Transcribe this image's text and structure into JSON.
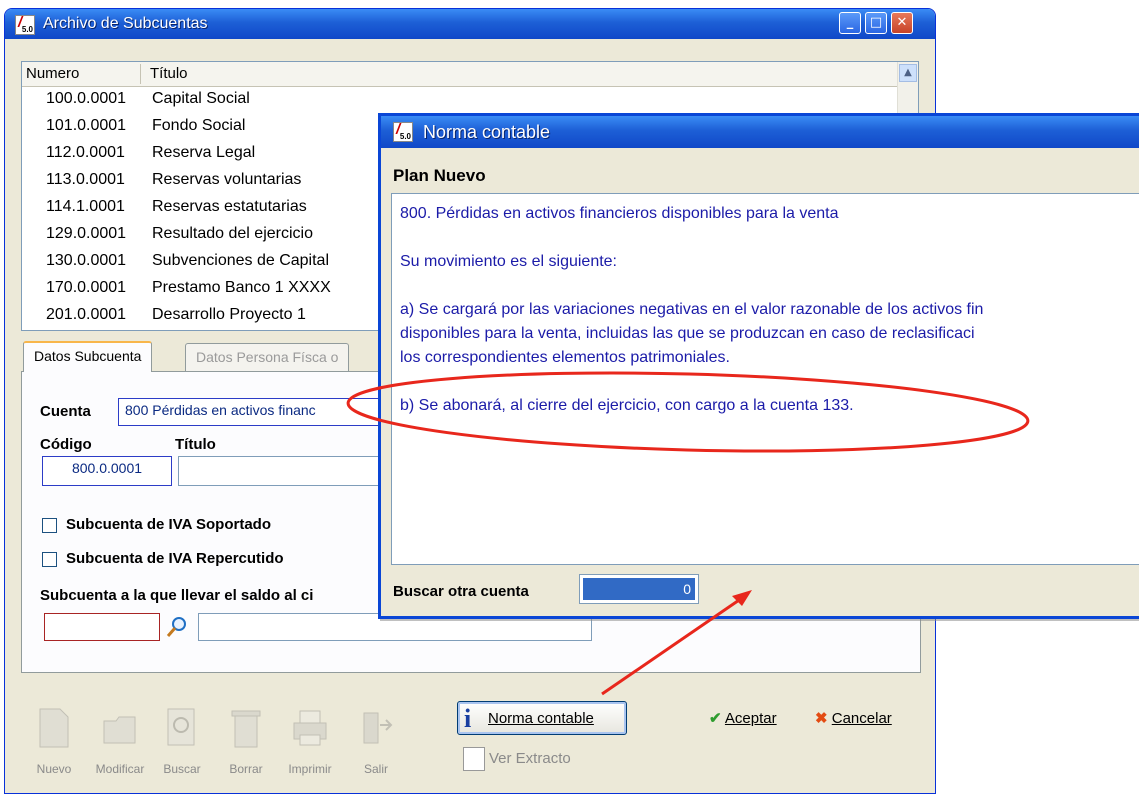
{
  "main_window": {
    "title": "Archivo de Subcuentas",
    "app_version": "5.0",
    "columns": [
      "Numero",
      "Título"
    ],
    "rows": [
      {
        "num": "100.0.0001",
        "title": "Capital Social"
      },
      {
        "num": "101.0.0001",
        "title": "Fondo Social"
      },
      {
        "num": "112.0.0001",
        "title": "Reserva Legal"
      },
      {
        "num": "113.0.0001",
        "title": "Reservas voluntarias"
      },
      {
        "num": "114.1.0001",
        "title": "Reservas estatutarias"
      },
      {
        "num": "129.0.0001",
        "title": "Resultado del ejercicio"
      },
      {
        "num": "130.0.0001",
        "title": "Subvenciones de Capital"
      },
      {
        "num": "170.0.0001",
        "title": "Prestamo Banco 1 XXXX"
      },
      {
        "num": "201.0.0001",
        "title": "Desarrollo Proyecto 1"
      }
    ],
    "tabs": [
      "Datos Subcuenta",
      "Datos Persona Físca o"
    ],
    "form": {
      "cuenta_label": "Cuenta",
      "cuenta_value": "800  Pérdidas en activos financ",
      "codigo_label": "Código",
      "codigo_value": "800.0.0001",
      "titulo_label": "Título",
      "titulo_value": "",
      "iva_soportado_label": "Subcuenta de IVA Soportado",
      "iva_repercutido_label": "Subcuenta de IVA Repercutido",
      "saldo_label": "Subcuenta a la que llevar el saldo al ci",
      "saldo_value": "",
      "saldo_desc": ""
    },
    "toolbar": [
      "Nuevo",
      "Modificar",
      "Buscar",
      "Borrar",
      "Imprimir",
      "Salir"
    ],
    "norma_button": "Norma contable",
    "ver_extracto": "Ver Extracto",
    "aceptar": "Aceptar",
    "cancelar": "Cancelar"
  },
  "modal": {
    "title": "Norma contable",
    "plan_label": "Plan Nuevo",
    "text_lines": [
      "800. Pérdidas en activos financieros disponibles para la venta",
      "",
      "Su movimiento es el siguiente:",
      "",
      "a) Se cargará por las variaciones negativas en el valor razonable de los activos fin",
      "disponibles para la venta, incluidas las que se produzcan en caso de reclasificaci",
      "los correspondientes elementos patrimoniales.",
      "",
      "b) Se abonará, al cierre del ejercicio, con cargo a la cuenta 133."
    ],
    "buscar_label": "Buscar otra cuenta",
    "buscar_value": "0"
  },
  "colors": {
    "annotation": "#e8271c",
    "title_bar": "#1d5fd6",
    "text_blue": "#1b1ba8"
  }
}
